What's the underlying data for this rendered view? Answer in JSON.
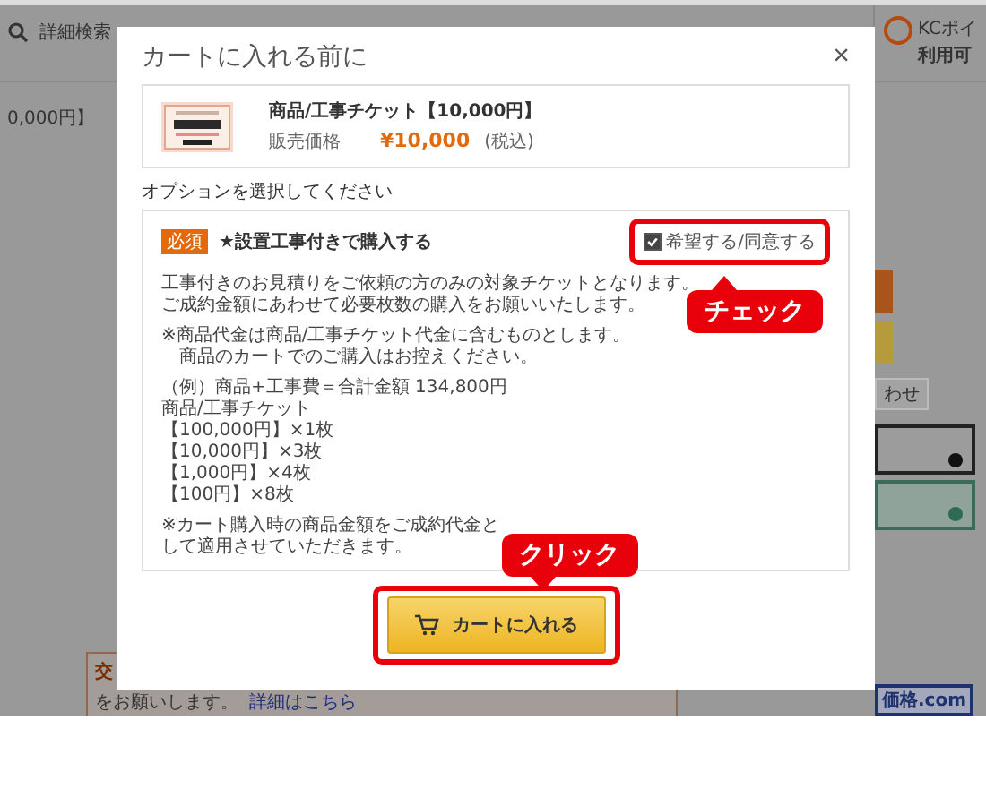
{
  "background_page": {
    "search_link": "詳細検索",
    "breadcrumb": "0,000円】",
    "points_title": "KCポイ",
    "points_sub": "利用可",
    "notice_title": "交",
    "notice_line": "をお願いします。",
    "notice_link": "詳細はこちら",
    "side_button": "わせ",
    "logo": "価格.com"
  },
  "modal": {
    "title": "カートに入れる前に",
    "close": "×",
    "product": {
      "name": "商品/工事チケット【10,000円】",
      "price_label": "販売価格",
      "price": "¥10,000",
      "tax": "(税込)"
    },
    "options_heading": "オプションを選択してください",
    "option": {
      "badge": "必須",
      "title": "★設置工事付きで購入する",
      "checkbox_label": "希望する/同意する",
      "checked": true,
      "paragraphs": [
        [
          "工事付きのお見積りをご依頼の方のみの対象チケットとなります。",
          "ご成約金額にあわせて必要枚数の購入をお願いいたします。"
        ],
        [
          "※商品代金は商品/工事チケット代金に含むものとします。",
          "　商品のカートでのご購入はお控えください。"
        ],
        [
          "（例）商品+工事費＝合計金額 134,800円",
          "商品/工事チケット",
          "【100,000円】×1枚",
          "【10,000円】×3枚",
          "【1,000円】×4枚",
          "【100円】×8枚"
        ],
        [
          "※カート購入時の商品金額をご成約代金として適用させていただきます。"
        ]
      ]
    },
    "button": "カートに入れる"
  },
  "callouts": [
    {
      "kind": "check",
      "text": "チェック"
    },
    {
      "kind": "click",
      "text": "クリック"
    }
  ]
}
